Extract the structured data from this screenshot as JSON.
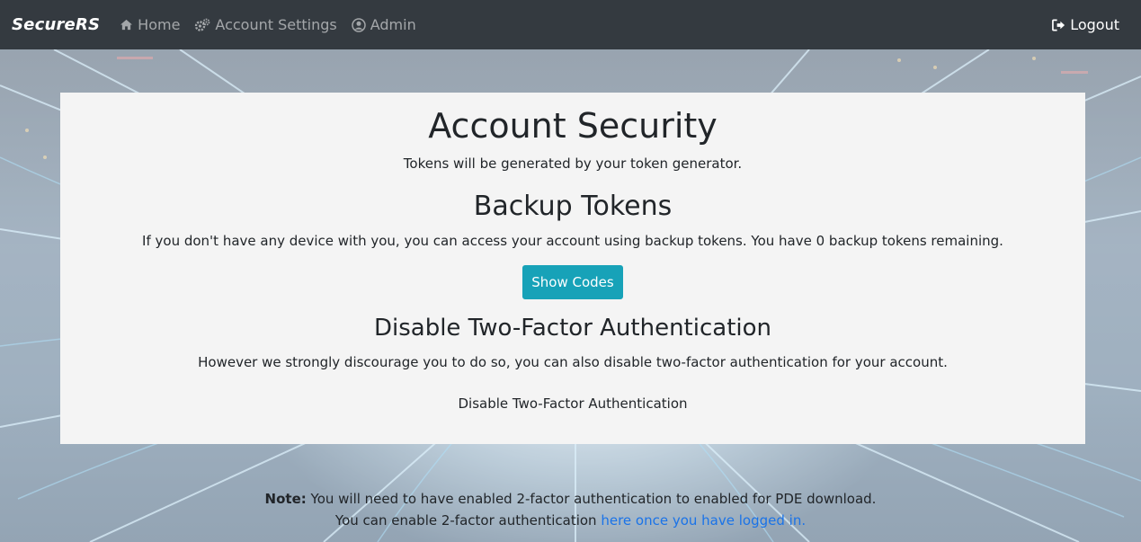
{
  "navbar": {
    "brand": "SecureRS",
    "items": [
      {
        "label": "Home",
        "icon": "home-icon"
      },
      {
        "label": "Account Settings",
        "icon": "cogs-icon"
      },
      {
        "label": "Admin",
        "icon": "user-circle-icon"
      }
    ],
    "logout_label": "Logout",
    "logout_icon": "sign-out-icon",
    "background_color": "#343a40"
  },
  "main": {
    "title": "Account Security",
    "subtitle": "Tokens will be generated by your token generator.",
    "backup_heading": "Backup Tokens",
    "backup_text": "If you don't have any device with you, you can access your account using backup tokens. You have 0 backup tokens remaining.",
    "show_codes_label": "Show Codes",
    "disable_heading": "Disable Two-Factor Authentication",
    "disable_text": "However we strongly discourage you to do so, you can also disable two-factor authentication for your account.",
    "disable_link": "Disable Two-Factor Authentication",
    "button_color": "#17a2b8"
  },
  "footer": {
    "note_label": "Note:",
    "note_text": " You will need to have enabled 2-factor authentication to enabled for PDE download.",
    "line2_text": "You can enable 2-factor authentication ",
    "line2_link": "here once you have logged in.",
    "link_color": "#1a73e8"
  }
}
